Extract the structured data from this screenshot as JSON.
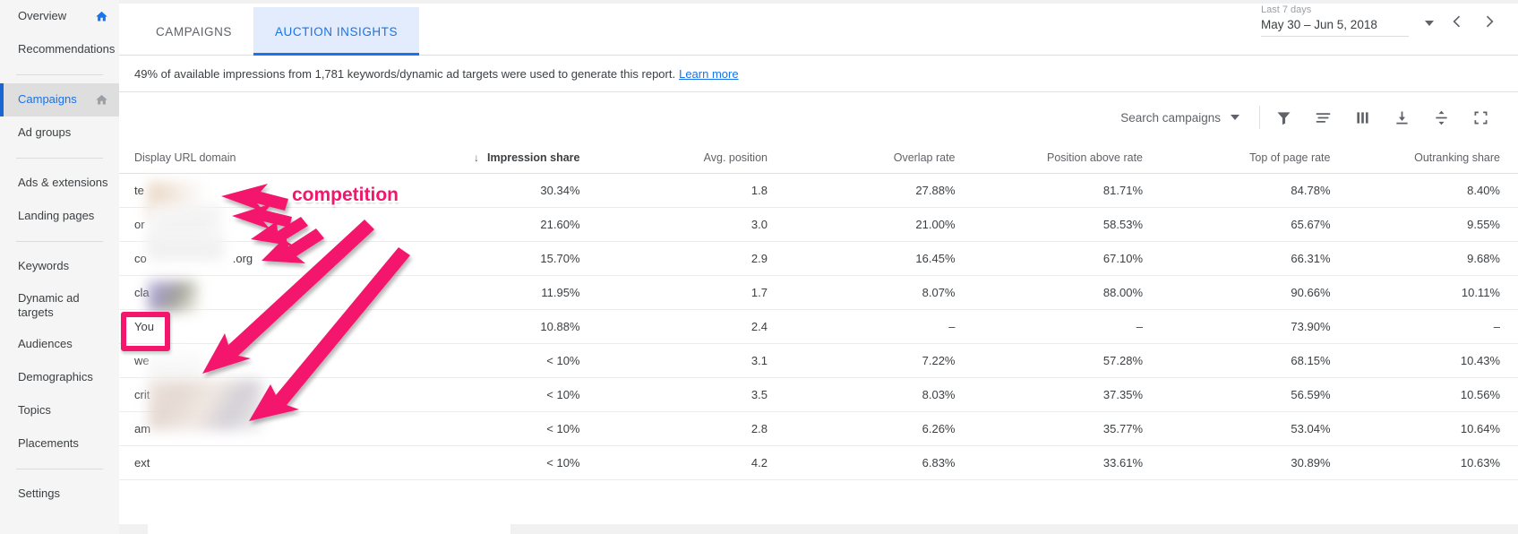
{
  "sidebar": {
    "items": [
      {
        "label": "Overview",
        "icon": "home-icon",
        "selected": false,
        "home": true
      },
      {
        "label": "Recommendations",
        "icon": null,
        "selected": false,
        "home": false
      },
      {
        "divider": true
      },
      {
        "label": "Campaigns",
        "icon": "home-icon",
        "selected": true,
        "home": true
      },
      {
        "label": "Ad groups",
        "icon": null,
        "selected": false,
        "home": false
      },
      {
        "divider": true
      },
      {
        "label": "Ads & extensions",
        "icon": null,
        "selected": false,
        "home": false
      },
      {
        "label": "Landing pages",
        "icon": null,
        "selected": false,
        "home": false
      },
      {
        "divider": true
      },
      {
        "label": "Keywords",
        "icon": null,
        "selected": false,
        "home": false
      },
      {
        "label": "Dynamic ad targets",
        "icon": null,
        "selected": false,
        "home": false
      },
      {
        "label": "Audiences",
        "icon": null,
        "selected": false,
        "home": false
      },
      {
        "label": "Demographics",
        "icon": null,
        "selected": false,
        "home": false
      },
      {
        "label": "Topics",
        "icon": null,
        "selected": false,
        "home": false
      },
      {
        "label": "Placements",
        "icon": null,
        "selected": false,
        "home": false
      },
      {
        "divider": true
      },
      {
        "label": "Settings",
        "icon": null,
        "selected": false,
        "home": false
      }
    ]
  },
  "tabs": [
    {
      "label": "CAMPAIGNS",
      "active": false
    },
    {
      "label": "AUCTION INSIGHTS",
      "active": true
    }
  ],
  "date_range": {
    "preset": "Last 7 days",
    "range": "May 30 – Jun 5, 2018",
    "caret": "chevron-down-icon",
    "prev": "chevron-left-icon",
    "next": "chevron-right-icon"
  },
  "notice": {
    "text": "49% of available impressions from 1,781 keywords/dynamic ad targets were used to generate this report.",
    "link": "Learn more"
  },
  "toolbar": {
    "search_label": "Search campaigns",
    "icons": [
      "filter-icon",
      "segment-icon",
      "columns-icon",
      "download-icon",
      "row-height-icon",
      "expand-icon"
    ]
  },
  "table": {
    "columns": [
      {
        "label": "Display URL domain",
        "sorted": false
      },
      {
        "label": "Impression share",
        "sorted": true,
        "sort_dir": "↓"
      },
      {
        "label": "Avg. position",
        "sorted": false
      },
      {
        "label": "Overlap rate",
        "sorted": false
      },
      {
        "label": "Position above rate",
        "sorted": false
      },
      {
        "label": "Top of page rate",
        "sorted": false
      },
      {
        "label": "Outranking share",
        "sorted": false
      }
    ],
    "rows": [
      {
        "domain": "te",
        "redacted": true,
        "you": false,
        "impression_share": "30.34%",
        "avg_position": "1.8",
        "overlap_rate": "27.88%",
        "position_above_rate": "81.71%",
        "top_of_page_rate": "84.78%",
        "outranking_share": "8.40%"
      },
      {
        "domain": "or",
        "redacted": true,
        "you": false,
        "impression_share": "21.60%",
        "avg_position": "3.0",
        "overlap_rate": "21.00%",
        "position_above_rate": "58.53%",
        "top_of_page_rate": "65.67%",
        "outranking_share": "9.55%"
      },
      {
        "domain": "co",
        "domain_suffix": ".org",
        "redacted": true,
        "you": false,
        "impression_share": "15.70%",
        "avg_position": "2.9",
        "overlap_rate": "16.45%",
        "position_above_rate": "67.10%",
        "top_of_page_rate": "66.31%",
        "outranking_share": "9.68%"
      },
      {
        "domain": "cla",
        "redacted": true,
        "you": false,
        "impression_share": "11.95%",
        "avg_position": "1.7",
        "overlap_rate": "8.07%",
        "position_above_rate": "88.00%",
        "top_of_page_rate": "90.66%",
        "outranking_share": "10.11%"
      },
      {
        "domain": "You",
        "redacted": false,
        "you": true,
        "impression_share": "10.88%",
        "avg_position": "2.4",
        "overlap_rate": "–",
        "position_above_rate": "–",
        "top_of_page_rate": "73.90%",
        "outranking_share": "–"
      },
      {
        "domain": "we",
        "redacted": true,
        "you": false,
        "impression_share": "< 10%",
        "avg_position": "3.1",
        "overlap_rate": "7.22%",
        "position_above_rate": "57.28%",
        "top_of_page_rate": "68.15%",
        "outranking_share": "10.43%"
      },
      {
        "domain": "crit",
        "redacted": true,
        "you": false,
        "impression_share": "< 10%",
        "avg_position": "3.5",
        "overlap_rate": "8.03%",
        "position_above_rate": "37.35%",
        "top_of_page_rate": "56.59%",
        "outranking_share": "10.56%"
      },
      {
        "domain": "am",
        "redacted": true,
        "you": false,
        "impression_share": "< 10%",
        "avg_position": "2.8",
        "overlap_rate": "6.26%",
        "position_above_rate": "35.77%",
        "top_of_page_rate": "53.04%",
        "outranking_share": "10.64%"
      },
      {
        "domain": "ext",
        "redacted": true,
        "you": false,
        "impression_share": "< 10%",
        "avg_position": "4.2",
        "overlap_rate": "6.83%",
        "position_above_rate": "33.61%",
        "top_of_page_rate": "30.89%",
        "outranking_share": "10.63%"
      }
    ]
  },
  "annotations": {
    "label": "competition",
    "color": "#f4156c",
    "highlight_target": "You"
  }
}
